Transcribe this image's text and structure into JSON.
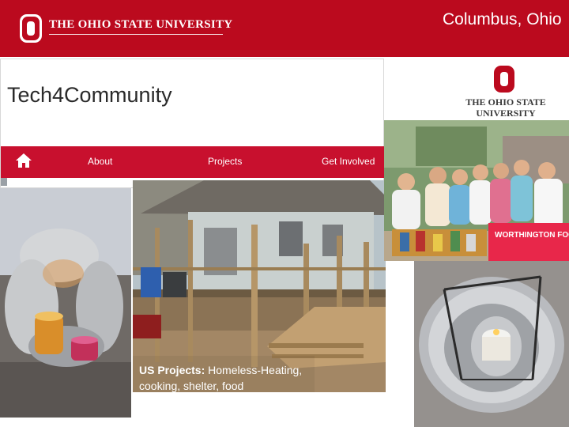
{
  "header": {
    "university": "THE OHIO STATE UNIVERSITY",
    "location": "Columbus, Ohio",
    "brand_color": "#bb0a1e"
  },
  "site": {
    "title": "Tech4Community",
    "nav": {
      "home_icon": "home-icon",
      "items": [
        "About",
        "Projects",
        "Get Involved"
      ]
    }
  },
  "badge": {
    "line1": "THE OHIO STATE",
    "line2": "UNIVERSITY"
  },
  "photos": {
    "solar_cooker": "solar-cooker-photo",
    "house": "house-construction-photo",
    "group": "group-photo",
    "candle_heater": "candle-heater-photo",
    "group_banner_text": "WORTHINGTON FOOD PANTRY"
  },
  "caption": {
    "label": "US Projects:",
    "text": " Homeless-Heating, cooking, shelter, food"
  }
}
